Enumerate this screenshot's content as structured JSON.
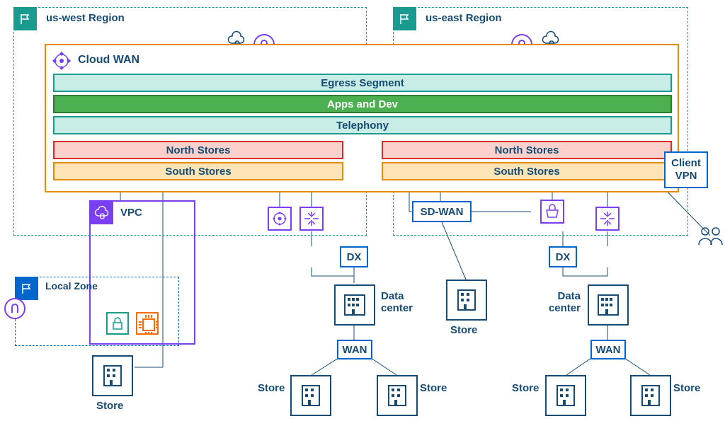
{
  "regions": {
    "west": "us-west Region",
    "east": "us-east Region"
  },
  "cloud_wan": {
    "title": "Cloud WAN"
  },
  "segments": {
    "egress": "Egress Segment",
    "apps": "Apps and Dev",
    "tel": "Telephony",
    "ns": "North Stores",
    "ss": "South Stores"
  },
  "services": {
    "sd_wan": "SD-WAN",
    "client_vpn": "Client VPN",
    "dx": "DX",
    "wan": "WAN",
    "vpc": "VPC",
    "local_zone": "Local Zone"
  },
  "labels": {
    "store": "Store",
    "datacenter": "Data center"
  }
}
